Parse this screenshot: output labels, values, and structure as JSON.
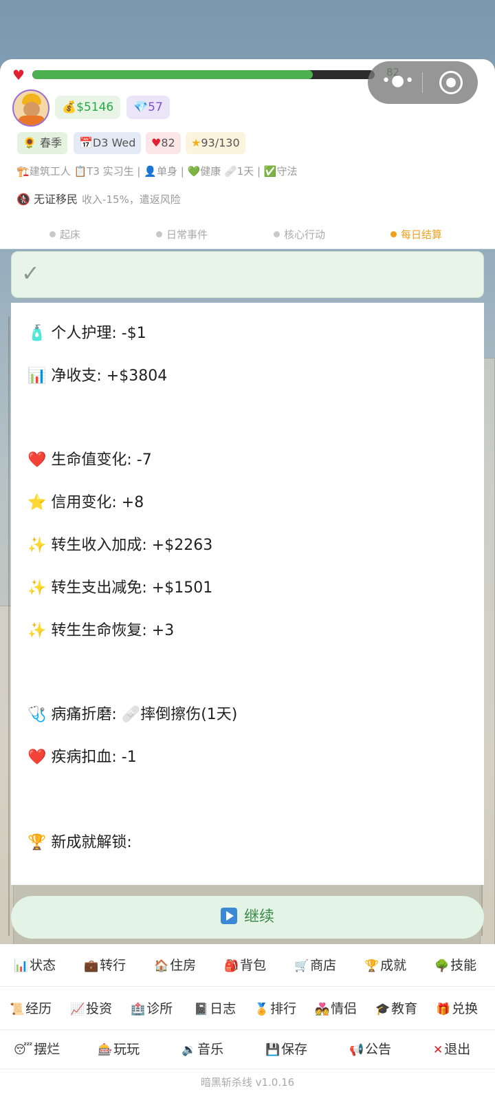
{
  "header": {
    "hp_value": "82",
    "hp_fraction": 0.82,
    "money": "$5146",
    "gems": "57",
    "season": "春季",
    "day": "D3 Wed",
    "hp_tag": "82",
    "credit": "93/130"
  },
  "status": {
    "job": "建筑工人",
    "level": "T3 实习生",
    "relationship": "单身",
    "health": "健康",
    "injury": "1天",
    "law": "守法",
    "identity_name": "无证移民",
    "identity_desc": "收入-15%，遣返风险"
  },
  "phases": [
    {
      "label": "起床",
      "active": false
    },
    {
      "label": "日常事件",
      "active": false
    },
    {
      "label": "核心行动",
      "active": false
    },
    {
      "label": "每日结算",
      "active": true
    }
  ],
  "log": [
    {
      "icon": "🧴",
      "text": "个人护理: -$1"
    },
    {
      "icon": "📊",
      "text": "净收支: +$3804"
    },
    {
      "icon": "❤️",
      "text": "生命值变化: -7"
    },
    {
      "icon": "⭐",
      "text": "信用变化: +8"
    },
    {
      "icon": "✨",
      "text": "转生收入加成: +$2263"
    },
    {
      "icon": "✨",
      "text": "转生支出减免: +$1501"
    },
    {
      "icon": "✨",
      "text": "转生生命恢复: +3"
    },
    {
      "icon": "🩺",
      "text": "病痛折磨: 🩹摔倒擦伤(1天)"
    },
    {
      "icon": "❤️",
      "text": "疾病扣血: -1"
    },
    {
      "icon": "🏆",
      "text": "新成就解锁:"
    }
  ],
  "continue_label": "继续",
  "nav": {
    "row1": [
      "状态",
      "转行",
      "住房",
      "背包",
      "商店",
      "成就",
      "技能"
    ],
    "row2": [
      "经历",
      "投资",
      "诊所",
      "日志",
      "排行",
      "情侣",
      "教育",
      "兑换"
    ],
    "row3": [
      "摆烂",
      "玩玩",
      "音乐",
      "保存",
      "公告",
      "退出"
    ]
  },
  "version": "暗黑斩杀线 v1.0.16",
  "colors": {
    "hp_fill": "#4caf50",
    "money_text": "#27a844",
    "active_phase": "#f0a020",
    "continue_bg": "#e3f3e6"
  }
}
